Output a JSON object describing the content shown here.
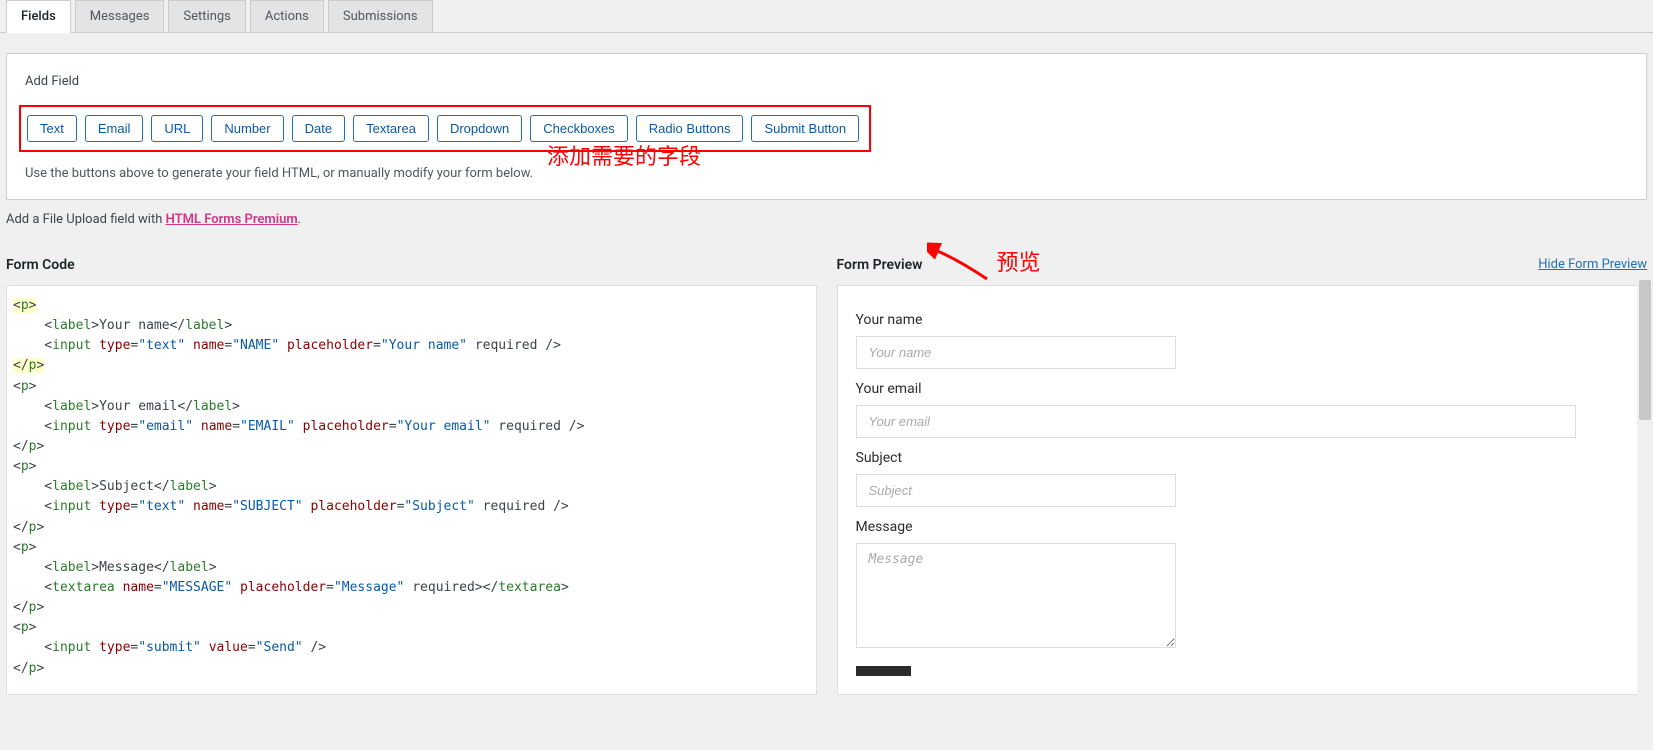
{
  "tabs": [
    "Fields",
    "Messages",
    "Settings",
    "Actions",
    "Submissions"
  ],
  "activeTab": 0,
  "addField": {
    "title": "Add Field",
    "buttons": [
      "Text",
      "Email",
      "URL",
      "Number",
      "Date",
      "Textarea",
      "Dropdown",
      "Checkboxes",
      "Radio Buttons",
      "Submit Button"
    ],
    "help": "Use the buttons above to generate your field HTML, or manually modify your form below.",
    "annotation": "添加需要的字段"
  },
  "uploadNote": {
    "prefix": "Add a File Upload field with ",
    "linkText": "HTML Forms Premium",
    "suffix": "."
  },
  "formCode": {
    "title": "Form Code",
    "code": "<p>\n    <label>Your name</label>\n    <input type=\"text\" name=\"NAME\" placeholder=\"Your name\" required />\n</p>\n<p>\n    <label>Your email</label>\n    <input type=\"email\" name=\"EMAIL\" placeholder=\"Your email\" required />\n</p>\n<p>\n    <label>Subject</label>\n    <input type=\"text\" name=\"SUBJECT\" placeholder=\"Subject\" required />\n</p>\n<p>\n    <label>Message</label>\n    <textarea name=\"MESSAGE\" placeholder=\"Message\" required></textarea>\n</p>\n<p>\n    <input type=\"submit\" value=\"Send\" />\n</p>"
  },
  "formPreview": {
    "title": "Form Preview",
    "hideLink": "Hide Form Preview",
    "annotation": "预览",
    "fields": [
      {
        "label": "Your name",
        "placeholder": "Your name",
        "type": "text"
      },
      {
        "label": "Your email",
        "placeholder": "Your email",
        "type": "email"
      },
      {
        "label": "Subject",
        "placeholder": "Subject",
        "type": "text"
      },
      {
        "label": "Message",
        "placeholder": "Message",
        "type": "textarea"
      }
    ]
  }
}
